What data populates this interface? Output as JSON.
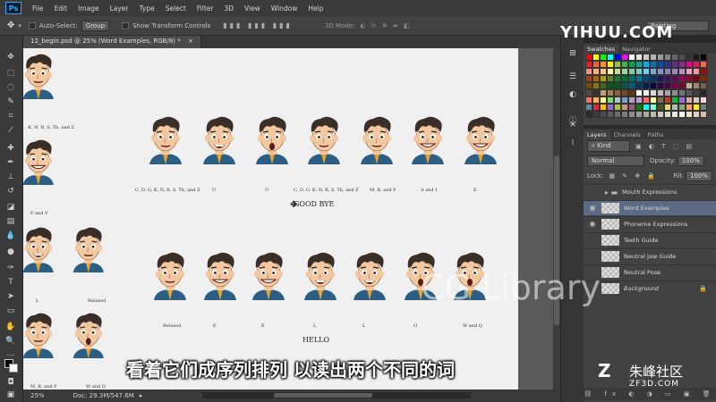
{
  "app": {
    "logo": "Ps",
    "menus": [
      "File",
      "Edit",
      "Image",
      "Layer",
      "Type",
      "Select",
      "Filter",
      "3D",
      "View",
      "Window",
      "Help"
    ]
  },
  "options_bar": {
    "auto_select_label": "Auto-Select:",
    "auto_select_value": "Group",
    "show_transform_label": "Show Transform Controls",
    "mode_label": "3D Mode:",
    "workspace_value": "Painting"
  },
  "document": {
    "tab_title": "12_begin.psd @ 25% (Word Examples, RGB/8) *",
    "zoom": "25%",
    "doc_info": "Doc: 29.3M/547.6M"
  },
  "canvas": {
    "left_column_labels": [
      ", K, N, R, S, Th, and Z",
      "F and V",
      "L",
      "Relaxed",
      "M, B, and P",
      "W and Q"
    ],
    "row1_labels": [
      "C, D, G, K, N, R, S, Th, and Z",
      "U",
      "U",
      "C, D, G, K, N, R, S, Th, and Z",
      "M, B, and P",
      "A and I",
      "E"
    ],
    "row1_word": "GOOD BYE",
    "row2_labels": [
      "Relaxed",
      "E",
      "E",
      "L",
      "L",
      "O",
      "W and Q"
    ],
    "row2_word": "HELLO"
  },
  "swatches_panel": {
    "tabs": [
      "Swatches",
      "Navigator"
    ]
  },
  "layers_panel": {
    "tabs": [
      "Layers",
      "Channels",
      "Paths"
    ],
    "filter_label": "Kind",
    "blend_mode": "Normal",
    "opacity_label": "Opacity:",
    "opacity_value": "100%",
    "lock_label": "Lock:",
    "fill_label": "Fill:",
    "fill_value": "100%",
    "layers": [
      {
        "name": "Mouth Expressions",
        "visible": false,
        "group": true
      },
      {
        "name": "Word Examples",
        "visible": true,
        "selected": true
      },
      {
        "name": "Phoneme Expressions",
        "visible": true
      },
      {
        "name": "Teeth Guide",
        "visible": false
      },
      {
        "name": "Neutral Jaw Guide",
        "visible": false
      },
      {
        "name": "Neutral Pose",
        "visible": false
      },
      {
        "name": "Background",
        "visible": false,
        "locked": true
      }
    ]
  },
  "overlay": {
    "subtitle": "看着它们成序列排列 以读出两个不同的词",
    "site_watermark": "YIHUU.COM",
    "library_watermark": "CG Library",
    "zf_logo": "Z",
    "zf_name": "朱峰社区",
    "zf_url": "ZF3D.COM"
  },
  "colors": {
    "accent": "#31a8ff",
    "selected_layer": "#5b6b85",
    "panel_bg": "#424242",
    "canvas_bg": "#f0f0f0",
    "shirt": "#2d5f85",
    "hair": "#3a2e28",
    "skin": "#f2c8a0"
  }
}
